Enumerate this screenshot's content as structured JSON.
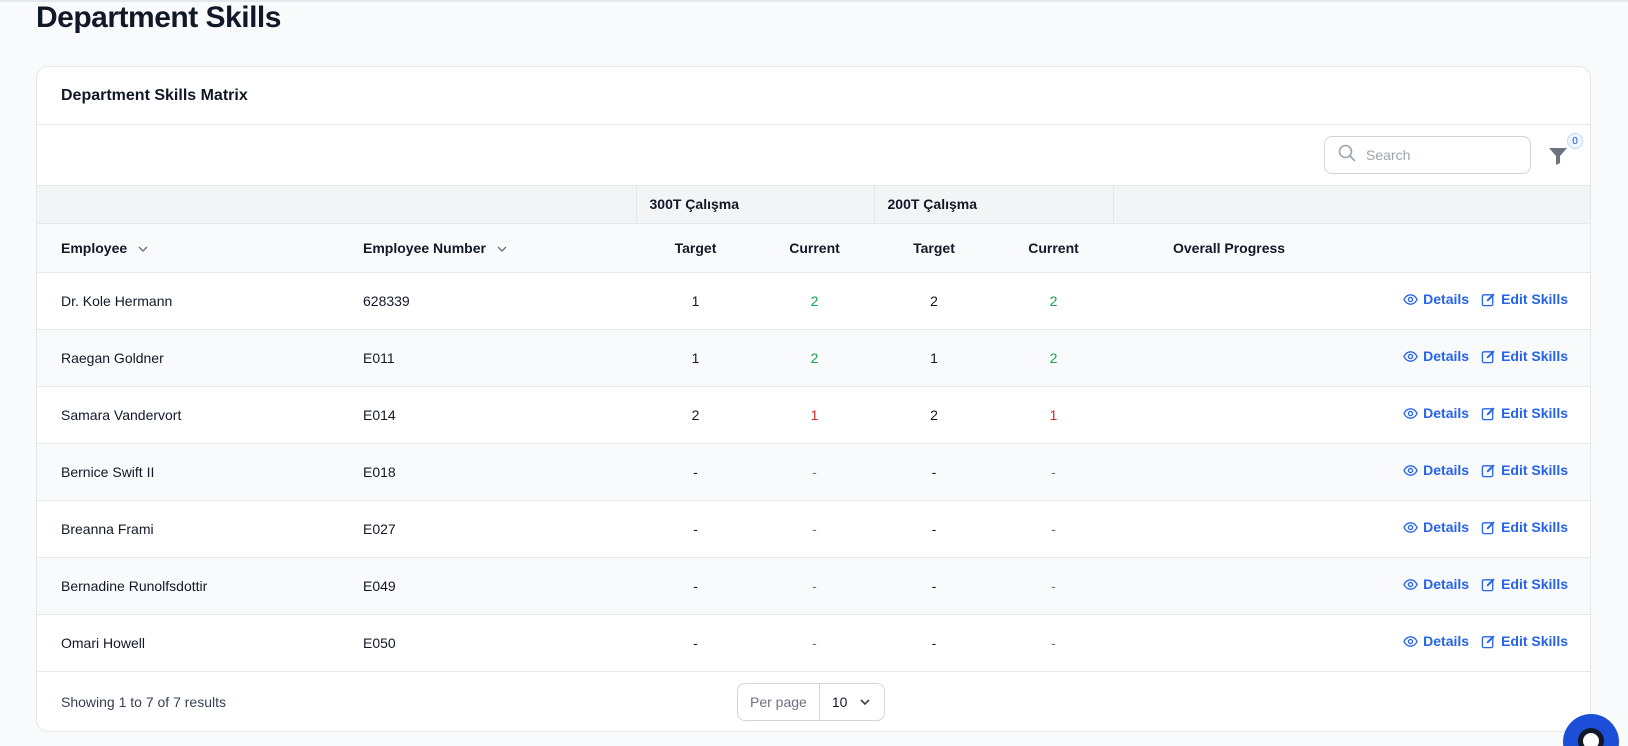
{
  "page": {
    "title": "Department Skills"
  },
  "card": {
    "title": "Department Skills Matrix"
  },
  "search": {
    "placeholder": "Search"
  },
  "filter": {
    "count": "0"
  },
  "table": {
    "groups": [
      "300T Çalışma",
      "200T Çalışma"
    ],
    "columns": {
      "employee": "Employee",
      "employee_number": "Employee Number",
      "target": "Target",
      "current": "Current",
      "overall": "Overall Progress"
    },
    "rows": [
      {
        "name": "Dr. Kole Hermann",
        "number": "628339",
        "g1_target": "1",
        "g1_current": "2",
        "g1_status": "green",
        "g2_target": "2",
        "g2_current": "2",
        "g2_status": "green"
      },
      {
        "name": "Raegan Goldner",
        "number": "E011",
        "g1_target": "1",
        "g1_current": "2",
        "g1_status": "green",
        "g2_target": "1",
        "g2_current": "2",
        "g2_status": "green"
      },
      {
        "name": "Samara Vandervort",
        "number": "E014",
        "g1_target": "2",
        "g1_current": "1",
        "g1_status": "red",
        "g2_target": "2",
        "g2_current": "1",
        "g2_status": "red"
      },
      {
        "name": "Bernice Swift II",
        "number": "E018",
        "g1_target": "-",
        "g1_current": "-",
        "g1_status": "muted",
        "g2_target": "-",
        "g2_current": "-",
        "g2_status": "muted"
      },
      {
        "name": "Breanna Frami",
        "number": "E027",
        "g1_target": "-",
        "g1_current": "-",
        "g1_status": "muted",
        "g2_target": "-",
        "g2_current": "-",
        "g2_status": "muted"
      },
      {
        "name": "Bernadine Runolfsdottir",
        "number": "E049",
        "g1_target": "-",
        "g1_current": "-",
        "g1_status": "muted",
        "g2_target": "-",
        "g2_current": "-",
        "g2_status": "muted"
      },
      {
        "name": "Omari Howell",
        "number": "E050",
        "g1_target": "-",
        "g1_current": "-",
        "g1_status": "muted",
        "g2_target": "-",
        "g2_current": "-",
        "g2_status": "muted"
      }
    ],
    "actions": {
      "details": "Details",
      "edit": "Edit Skills"
    }
  },
  "footer": {
    "showing": "Showing 1 to 7 of 7 results",
    "per_page_label": "Per page",
    "per_page_value": "10"
  },
  "colors": {
    "accent": "#2563eb",
    "ok": "#16a34a",
    "bad": "#dc2626"
  }
}
